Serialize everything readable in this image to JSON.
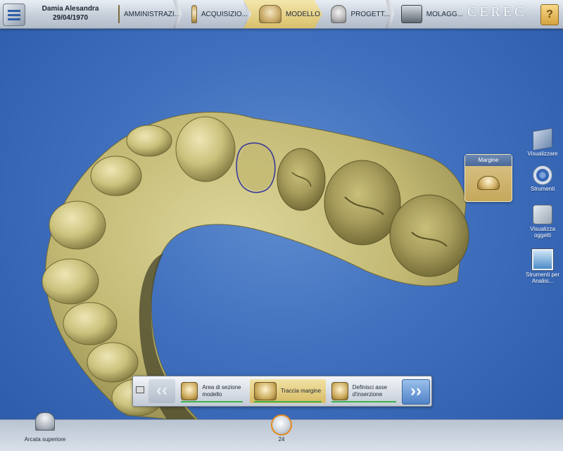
{
  "patient": {
    "name": "Damia Alesandra",
    "dob": "29/04/1970"
  },
  "phases": [
    {
      "label": "AMMINISTRAZI...",
      "icon": "model-icon"
    },
    {
      "label": "ACQUISIZIO...",
      "icon": "scan-icon"
    },
    {
      "label": "MODELLO",
      "icon": "model-icon",
      "active": true
    },
    {
      "label": "PROGETT...",
      "icon": "design-icon"
    },
    {
      "label": "MOLAGG...",
      "icon": "milling-icon"
    }
  ],
  "brand": "CEREC",
  "side_tools": [
    {
      "label": "Visualizzare",
      "icon": "cube-icon"
    },
    {
      "label": "Strumenti",
      "icon": "tools-ring-icon"
    },
    {
      "label": "Visualizza oggetti",
      "icon": "objects-icon"
    },
    {
      "label": "Strumenti per Analisi...",
      "icon": "analysis-monitor-icon"
    }
  ],
  "margin_panel": {
    "title": "Margine",
    "icon": "crown-icon"
  },
  "workflow": {
    "steps": [
      {
        "label": "Area di sezione modello"
      },
      {
        "label": "Traccia margine",
        "active": true
      },
      {
        "label": "Definisci asse d'inserzione"
      }
    ],
    "prev": "‹‹",
    "next": "››"
  },
  "bottom": {
    "arch_label": "Arcata superiore",
    "tooth_number": "24"
  },
  "colors": {
    "accent": "#d9c06a",
    "model": "#c8bf79",
    "background": "#3f6fbd",
    "margin_line": "#3a3a9a"
  }
}
